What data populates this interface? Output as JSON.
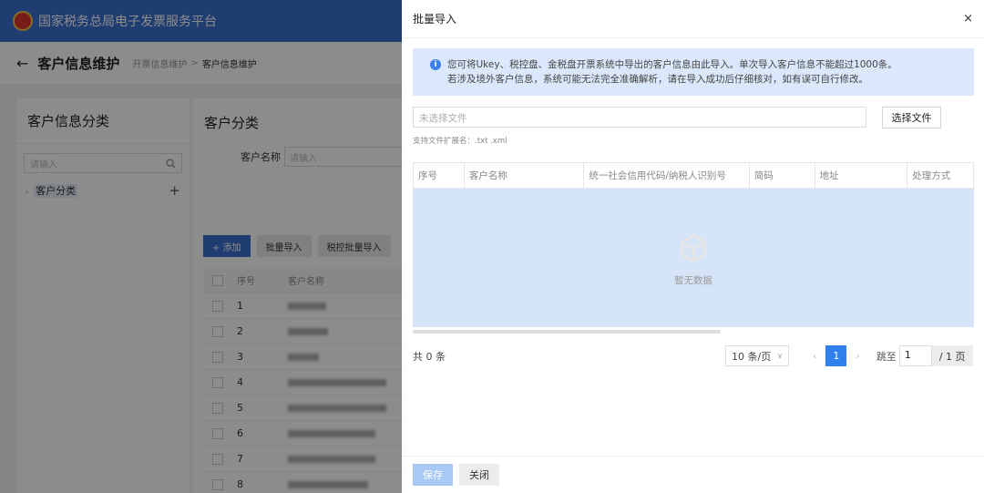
{
  "app": {
    "title": "国家税务总局电子发票服务平台"
  },
  "breadcrumb": {
    "back_icon": "arrow-left-icon",
    "page_title": "客户信息维护",
    "link": "开票信息维护",
    "separator": ">",
    "current": "客户信息维护"
  },
  "left_panel": {
    "title": "客户信息分类",
    "search_placeholder": "请输入",
    "tree_root": "客户分类",
    "add_symbol": "+"
  },
  "main_panel": {
    "title": "客户分类",
    "filter_label": "客户名称",
    "filter_placeholder": "请输入",
    "add_button": "+ 添加",
    "import_button": "批量导入",
    "tax_import_button": "税控批量导入",
    "columns": [
      "序号",
      "客户名称"
    ],
    "row_numbers": [
      "1",
      "2",
      "3",
      "4",
      "5",
      "6",
      "7",
      "8"
    ]
  },
  "drawer": {
    "title": "批量导入",
    "close_symbol": "×",
    "notice_line1": "您可将Ukey、税控盘、金税盘开票系统中导出的客户信息由此导入。单次导入客户信息不能超过1000条。",
    "notice_line2": "若涉及境外客户信息，系统可能无法完全准确解析，请在导入成功后仔细核对，如有误可自行修改。",
    "file_placeholder": "未选择文件",
    "choose_file_button": "选择文件",
    "ext_hint": "支持文件扩展名：.txt .xml",
    "table": {
      "columns": [
        "序号",
        "客户名称",
        "统一社会信用代码/纳税人识别号",
        "简码",
        "地址",
        "处理方式"
      ],
      "empty_text": "暂无数据"
    },
    "total_text": "共 0 条",
    "pagination": {
      "page_size": "10 条/页",
      "current_page": "1",
      "jump_label": "跳至",
      "jump_value": "1",
      "total_pages": "/ 1 页"
    },
    "footer": {
      "save_button": "保存",
      "close_button": "关闭"
    }
  },
  "colors": {
    "primary": "#3b6fd0",
    "notice_bg": "#dbe8fb",
    "page_active": "#2f80ed"
  }
}
